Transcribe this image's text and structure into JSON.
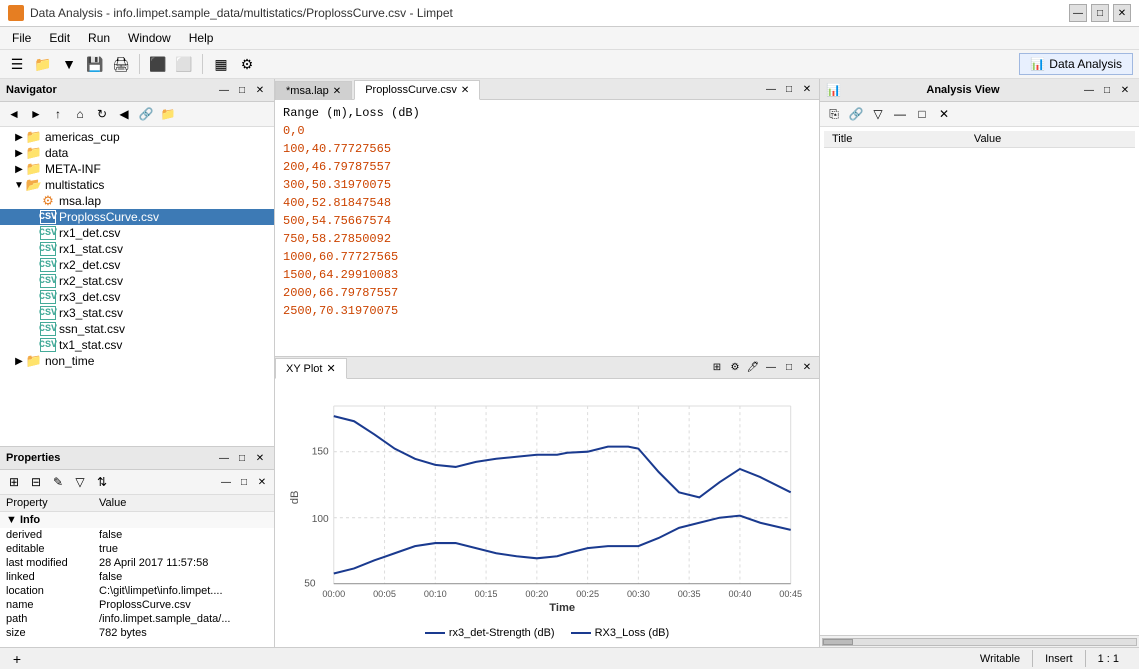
{
  "titlebar": {
    "title": "Data Analysis - info.limpet.sample_data/multistatics/ProplossCurve.csv - Limpet",
    "icon": "chart-icon"
  },
  "menubar": {
    "items": [
      "File",
      "Edit",
      "Run",
      "Window",
      "Help"
    ]
  },
  "toolbar": {
    "data_analysis_label": "Data Analysis"
  },
  "navigator": {
    "title": "Navigator",
    "tree": [
      {
        "id": "americas_cup",
        "label": "americas_cup",
        "type": "folder",
        "indent": 1,
        "expanded": false
      },
      {
        "id": "data",
        "label": "data",
        "type": "folder",
        "indent": 1,
        "expanded": false
      },
      {
        "id": "meta_inf",
        "label": "META-INF",
        "type": "folder",
        "indent": 1,
        "expanded": false
      },
      {
        "id": "multistatics",
        "label": "multistatics",
        "type": "folder",
        "indent": 1,
        "expanded": true
      },
      {
        "id": "msa_lap",
        "label": "msa.lap",
        "type": "lap",
        "indent": 2,
        "expanded": false
      },
      {
        "id": "proploss",
        "label": "ProplossCurve.csv",
        "type": "csv",
        "indent": 2,
        "expanded": false,
        "selected": true
      },
      {
        "id": "rx1_det",
        "label": "rx1_det.csv",
        "type": "csv",
        "indent": 2,
        "expanded": false
      },
      {
        "id": "rx1_stat",
        "label": "rx1_stat.csv",
        "type": "csv",
        "indent": 2,
        "expanded": false
      },
      {
        "id": "rx2_det",
        "label": "rx2_det.csv",
        "type": "csv",
        "indent": 2,
        "expanded": false
      },
      {
        "id": "rx2_stat",
        "label": "rx2_stat.csv",
        "type": "csv",
        "indent": 2,
        "expanded": false
      },
      {
        "id": "rx3_det",
        "label": "rx3_det.csv",
        "type": "csv",
        "indent": 2,
        "expanded": false
      },
      {
        "id": "rx3_stat",
        "label": "rx3_stat.csv",
        "type": "csv",
        "indent": 2,
        "expanded": false
      },
      {
        "id": "ssn_stat",
        "label": "ssn_stat.csv",
        "type": "csv",
        "indent": 2,
        "expanded": false
      },
      {
        "id": "tx1_stat",
        "label": "tx1_stat.csv",
        "type": "csv",
        "indent": 2,
        "expanded": false
      },
      {
        "id": "non_time",
        "label": "non_time",
        "type": "folder",
        "indent": 1,
        "expanded": false
      }
    ]
  },
  "editor": {
    "tabs": [
      {
        "label": "*msa.lap",
        "active": false,
        "closable": true
      },
      {
        "label": "ProplossCurve.csv",
        "active": true,
        "closable": true
      }
    ],
    "lines": [
      {
        "text": "Range (m),Loss (dB)",
        "header": true
      },
      {
        "text": "0,0"
      },
      {
        "text": "100,40.77727565"
      },
      {
        "text": "200,46.79787557"
      },
      {
        "text": "300,50.31970075"
      },
      {
        "text": "400,52.81847548"
      },
      {
        "text": "500,54.75667574"
      },
      {
        "text": "750,58.27850092"
      },
      {
        "text": "1000,60.77727565"
      },
      {
        "text": "1500,64.29910083"
      },
      {
        "text": "2000,66.79787557"
      },
      {
        "text": "2500,70.31970075"
      }
    ]
  },
  "plot": {
    "title": "XY Plot",
    "x_axis_label": "Time",
    "x_ticks": [
      "00:00",
      "00:05",
      "00:10",
      "00:15",
      "00:20",
      "00:25",
      "00:30",
      "00:35",
      "00:40",
      "00:45"
    ],
    "y_axis_label": "dB",
    "y_ticks": [
      "50",
      "100"
    ],
    "legend": [
      {
        "label": "rx3_det-Strength (dB)",
        "color": "#1a3a8f"
      },
      {
        "label": "RX3_Loss (dB)",
        "color": "#1a3a8f"
      }
    ]
  },
  "properties": {
    "title": "Properties",
    "columns": {
      "property": "Property",
      "value": "Value"
    },
    "groups": [
      {
        "name": "Info",
        "items": [
          {
            "property": "derived",
            "value": "false"
          },
          {
            "property": "editable",
            "value": "true"
          },
          {
            "property": "last modified",
            "value": "28 April 2017 11:57:58"
          },
          {
            "property": "linked",
            "value": "false"
          },
          {
            "property": "location",
            "value": "C:\\git\\limpet\\info.limpet...."
          },
          {
            "property": "name",
            "value": "ProplossCurve.csv"
          },
          {
            "property": "path",
            "value": "/info.limpet.sample_data/..."
          },
          {
            "property": "size",
            "value": "782  bytes"
          }
        ]
      }
    ]
  },
  "analysis": {
    "title": "Analysis View",
    "columns": {
      "title": "Title",
      "value": "Value"
    }
  },
  "statusbar": {
    "segments": [
      "Writable",
      "Insert",
      "1 : 1"
    ]
  },
  "icons": {
    "minimize": "—",
    "maximize": "□",
    "close": "✕",
    "arrow_right": "▶",
    "arrow_down": "▼",
    "back": "←",
    "forward": "→",
    "up": "↑",
    "home": "⌂",
    "refresh": "↻",
    "collapse": "◀",
    "nav_back": "◄",
    "nav_fwd": "►",
    "copy": "⎘",
    "link": "🔗",
    "new_folder": "📁",
    "gear": "⚙",
    "pin": "📌",
    "chart_icon": "📊",
    "filter": "▽",
    "sort": "⇅",
    "add": "+"
  }
}
